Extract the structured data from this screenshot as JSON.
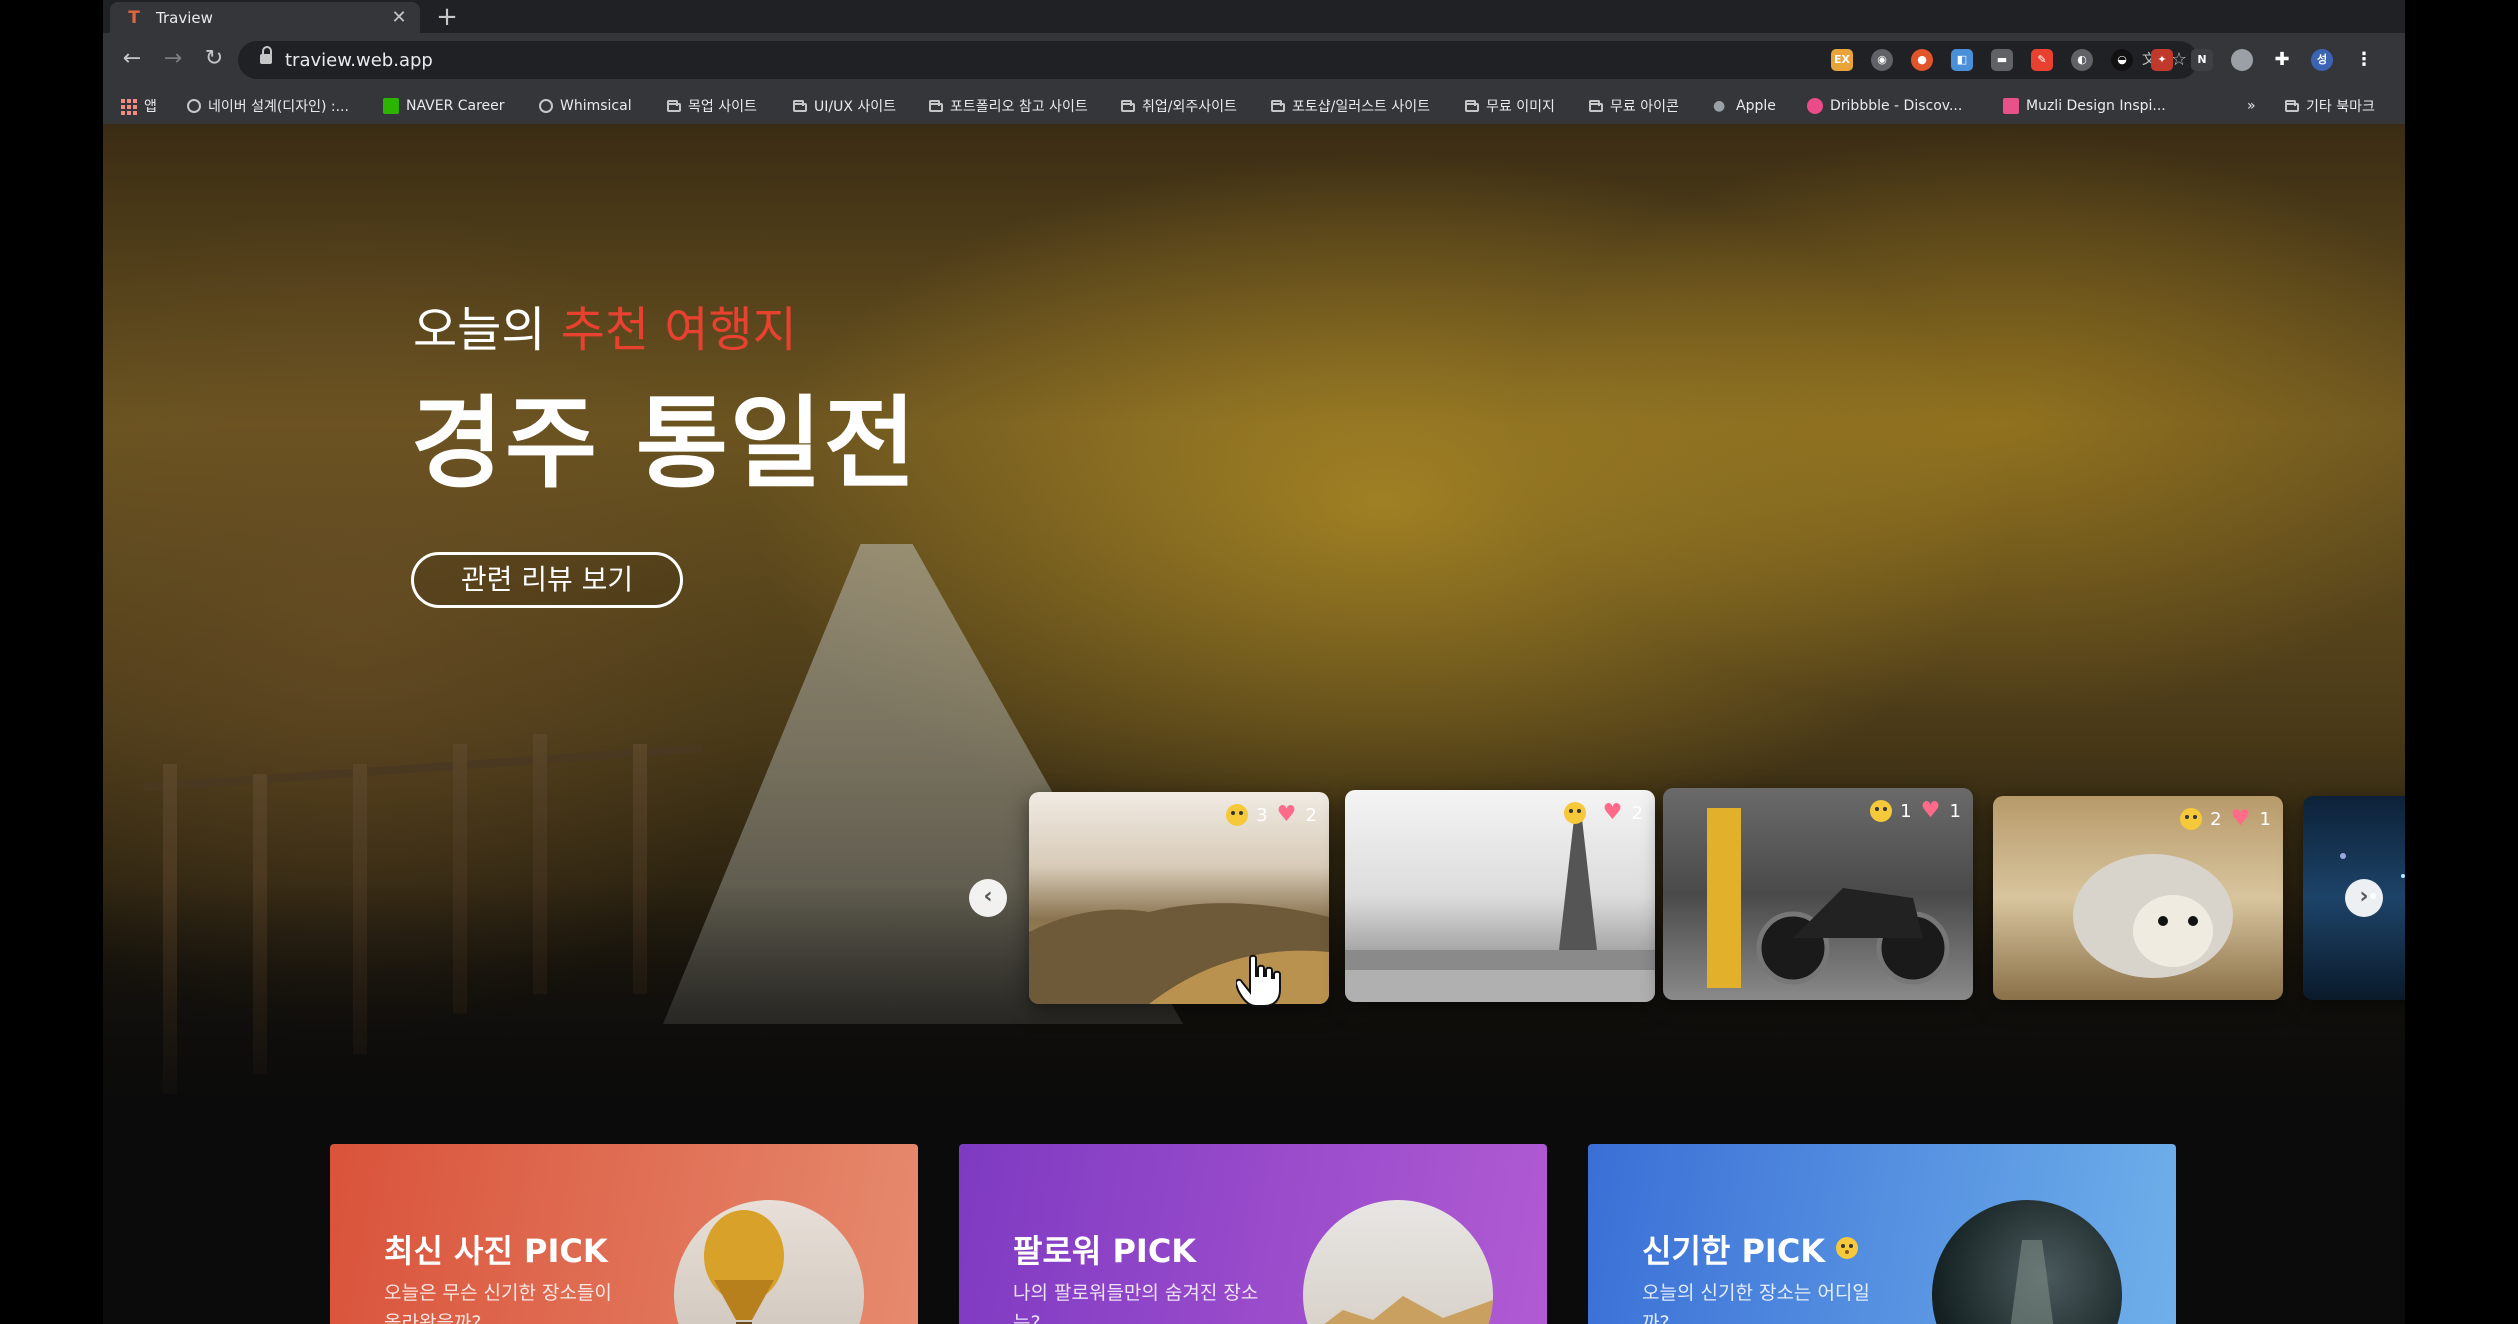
{
  "browser": {
    "tab_title": "Traview",
    "url": "traview.web.app",
    "bookmarks": [
      {
        "label": "앱",
        "icon": "apps-grid-icon"
      },
      {
        "label": "네이버 설계(디자인) :...",
        "icon": "globe-icon"
      },
      {
        "label": "NAVER Career",
        "icon": "naver-icon"
      },
      {
        "label": "Whimsical",
        "icon": "globe-icon"
      },
      {
        "label": "목업 사이트",
        "icon": "folder-icon"
      },
      {
        "label": "UI/UX 사이트",
        "icon": "folder-icon"
      },
      {
        "label": "포트폴리오 참고 사이트",
        "icon": "folder-icon"
      },
      {
        "label": "취업/외주사이트",
        "icon": "folder-icon"
      },
      {
        "label": "포토샵/일러스트 사이트",
        "icon": "folder-icon"
      },
      {
        "label": "무료 이미지",
        "icon": "folder-icon"
      },
      {
        "label": "무료 아이콘",
        "icon": "folder-icon"
      },
      {
        "label": "Apple",
        "icon": "apple-icon"
      },
      {
        "label": "Dribbble - Discov...",
        "icon": "dribbble-icon"
      },
      {
        "label": "Muzli Design Inspi...",
        "icon": "muzli-icon"
      }
    ],
    "bookmarks_more": "»",
    "other_bookmarks": "기타 북마크"
  },
  "hero": {
    "subtitle_prefix": "오늘의",
    "subtitle_highlight": "추천 여행지",
    "title": "경주 통일전",
    "button_label": "관련 리뷰 보기",
    "highlight_color": "#e8412f"
  },
  "carousel": {
    "cards": [
      {
        "name": "mountain",
        "emoji_count": "3",
        "like_count": "2"
      },
      {
        "name": "eiffel-tower",
        "emoji_count": "",
        "like_count": "2"
      },
      {
        "name": "motorcycle",
        "emoji_count": "1",
        "like_count": "1"
      },
      {
        "name": "hedgehog",
        "emoji_count": "2",
        "like_count": "1"
      },
      {
        "name": "night-city",
        "emoji_count": "",
        "like_count": ""
      }
    ]
  },
  "picks": [
    {
      "title": "최신 사진 PICK",
      "desc": "오늘은 무슨 신기한 장소들이 올라왔을까?",
      "color_start": "#e05b3f",
      "color_end": "#e8876a"
    },
    {
      "title": "팔로워 PICK",
      "desc": "나의 팔로워들만의 숨겨진 장소는?",
      "color_start": "#8a3fc4",
      "color_end": "#b056d0"
    },
    {
      "title": "신기한 PICK",
      "desc": "오늘의 신기한 장소는 어디일까?",
      "color_start": "#3a6fd8",
      "color_end": "#6aa8e8"
    }
  ]
}
